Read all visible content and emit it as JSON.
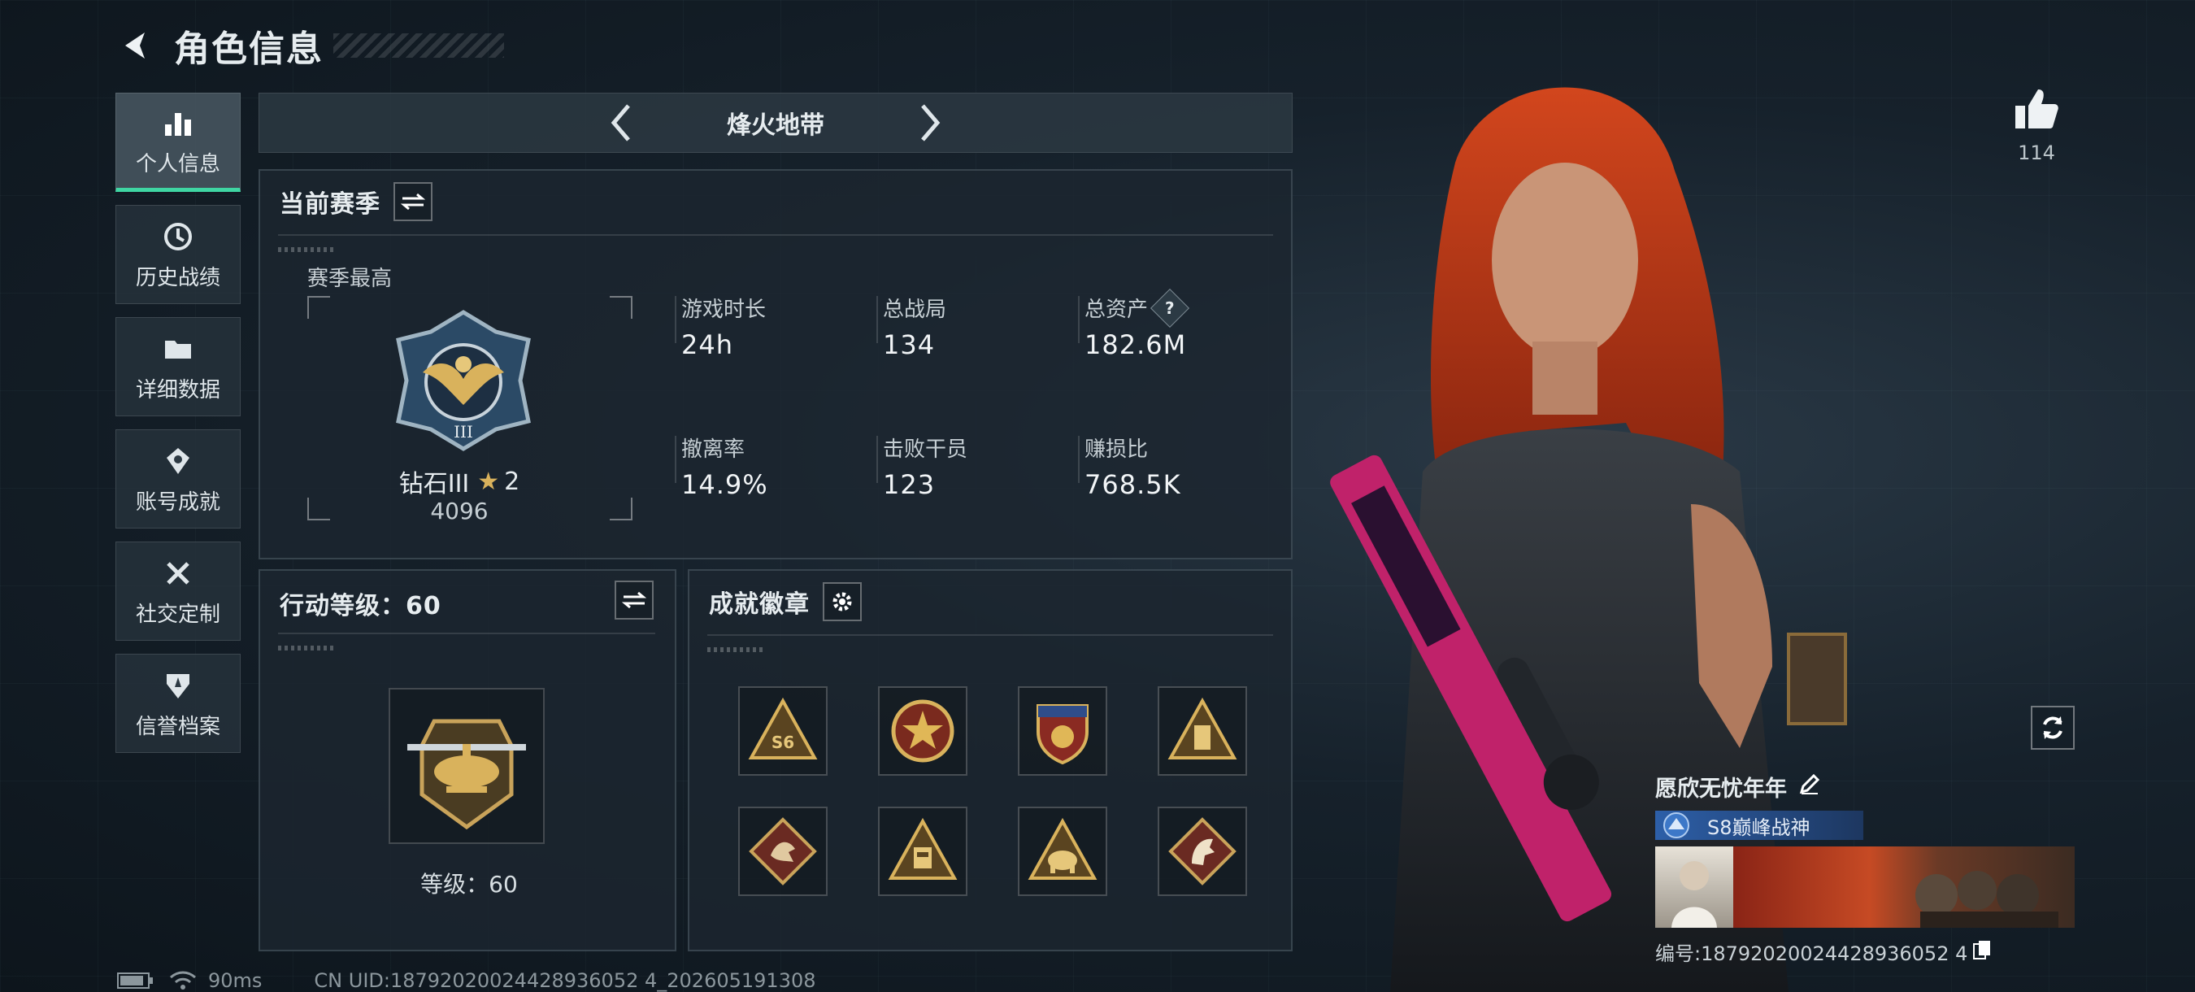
{
  "header": {
    "title": "角色信息"
  },
  "nav": {
    "items": [
      {
        "label": "个人信息",
        "icon": "bar-chart-icon",
        "active": true
      },
      {
        "label": "历史战绩",
        "icon": "history-icon",
        "active": false
      },
      {
        "label": "详细数据",
        "icon": "folder-icon",
        "active": false
      },
      {
        "label": "账号成就",
        "icon": "medal-icon",
        "active": false
      },
      {
        "label": "社交定制",
        "icon": "tools-icon",
        "active": false
      },
      {
        "label": "信誉档案",
        "icon": "shield-icon",
        "active": false
      }
    ]
  },
  "mode": {
    "name": "烽火地带"
  },
  "season": {
    "title": "当前赛季",
    "best_label": "赛季最高",
    "rank_name": "钻石III",
    "rank_stars": "2",
    "rank_score": "4096",
    "stats": [
      {
        "label": "游戏时长",
        "value": "24h"
      },
      {
        "label": "总战局",
        "value": "134"
      },
      {
        "label": "总资产",
        "value": "182.6M",
        "help": "?"
      },
      {
        "label": "撤离率",
        "value": "14.9%"
      },
      {
        "label": "击败干员",
        "value": "123"
      },
      {
        "label": "赚损比",
        "value": "768.5K"
      }
    ]
  },
  "action": {
    "title": "行动等级：60",
    "level_text": "等级：60"
  },
  "badges": {
    "title": "成就徽章",
    "items": [
      {
        "icon": "s6-triangle-badge-icon"
      },
      {
        "icon": "star-circle-badge-icon"
      },
      {
        "icon": "eagle-shield-badge-icon"
      },
      {
        "icon": "tower-triangle-badge-icon"
      },
      {
        "icon": "dragon-diamond-badge-icon"
      },
      {
        "icon": "robot-triangle-badge-icon"
      },
      {
        "icon": "elephant-triangle-badge-icon"
      },
      {
        "icon": "horse-diamond-badge-icon"
      }
    ]
  },
  "likes": {
    "count": "114"
  },
  "player": {
    "name": "愿欣无忧年年",
    "title_badge": "S8巅峰战神",
    "id_label": "编号:1879202002442893605 24",
    "id_text": "编号:18792020024428936052 4"
  },
  "status": {
    "ping": "90ms",
    "uid": "CN UID:18792020024428936052 4_202605191308"
  },
  "colors": {
    "accent": "#3fd6a3",
    "gold": "#d9b25c"
  }
}
